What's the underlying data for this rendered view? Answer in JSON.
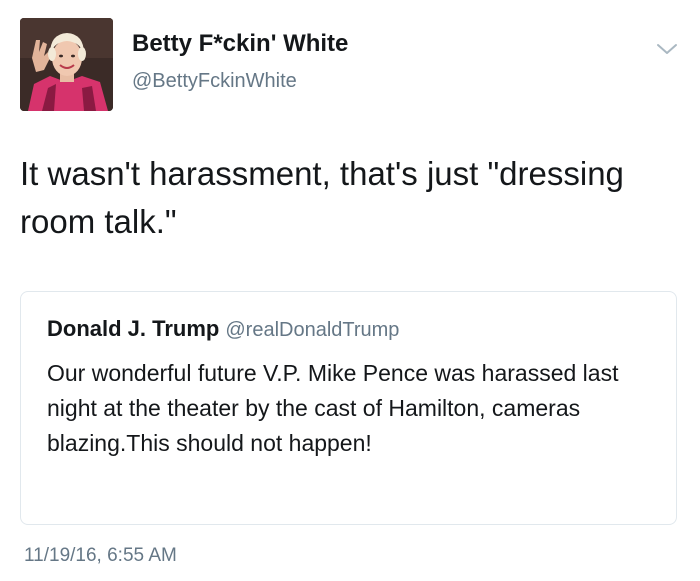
{
  "tweet": {
    "author_name": "Betty F*ckin' White",
    "author_handle": "@BettyFckinWhite",
    "text": "It wasn't harassment, that's just \"dressing room talk.\"",
    "timestamp": "11/19/16, 6:55 AM"
  },
  "quoted_tweet": {
    "author_name": "Donald J. Trump",
    "author_handle": "@realDonaldTrump",
    "text": "Our wonderful future V.P. Mike Pence was harassed last night at the theater by the cast of Hamilton, cameras blazing.This should not happen!"
  },
  "icons": {
    "menu": "chevron-down-icon"
  },
  "colors": {
    "primary_text": "#14171a",
    "secondary_text": "#657786",
    "border": "#e1e8ed"
  }
}
